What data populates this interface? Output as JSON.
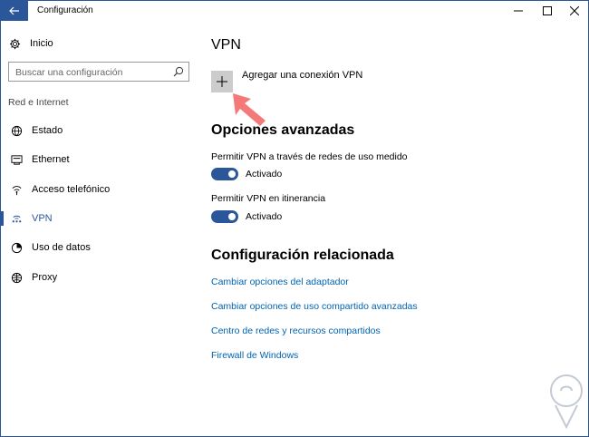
{
  "window": {
    "title": "Configuración",
    "back_icon": "arrow-left-icon",
    "controls": [
      "minimize-icon",
      "maximize-icon",
      "close-icon"
    ]
  },
  "sidebar": {
    "home": {
      "label": "Inicio",
      "icon": "gear-icon"
    },
    "search": {
      "placeholder": "Buscar una configuración",
      "icon": "search-icon"
    },
    "section": "Red e Internet",
    "items": [
      {
        "label": "Estado",
        "icon": "globe-status-icon",
        "active": false
      },
      {
        "label": "Ethernet",
        "icon": "ethernet-icon",
        "active": false
      },
      {
        "label": "Acceso telefónico",
        "icon": "dialup-icon",
        "active": false
      },
      {
        "label": "VPN",
        "icon": "vpn-icon",
        "active": true
      },
      {
        "label": "Uso de datos",
        "icon": "data-usage-icon",
        "active": false
      },
      {
        "label": "Proxy",
        "icon": "globe-icon",
        "active": false
      }
    ]
  },
  "main": {
    "heading": "VPN",
    "add_vpn": {
      "label": "Agregar una conexión VPN",
      "icon": "plus-icon"
    },
    "advanced": {
      "heading": "Opciones avanzadas",
      "options": [
        {
          "label": "Permitir VPN a través de redes de uso medido",
          "state": "Activado",
          "on": true
        },
        {
          "label": "Permitir VPN en itinerancia",
          "state": "Activado",
          "on": true
        }
      ]
    },
    "related": {
      "heading": "Configuración relacionada",
      "links": [
        "Cambiar opciones del adaptador",
        "Cambiar opciones de uso compartido avanzadas",
        "Centro de redes y recursos compartidos",
        "Firewall de Windows"
      ]
    }
  },
  "colors": {
    "accent": "#2b579a",
    "link": "#0063b1",
    "annotation_arrow": "#f47a7a"
  }
}
